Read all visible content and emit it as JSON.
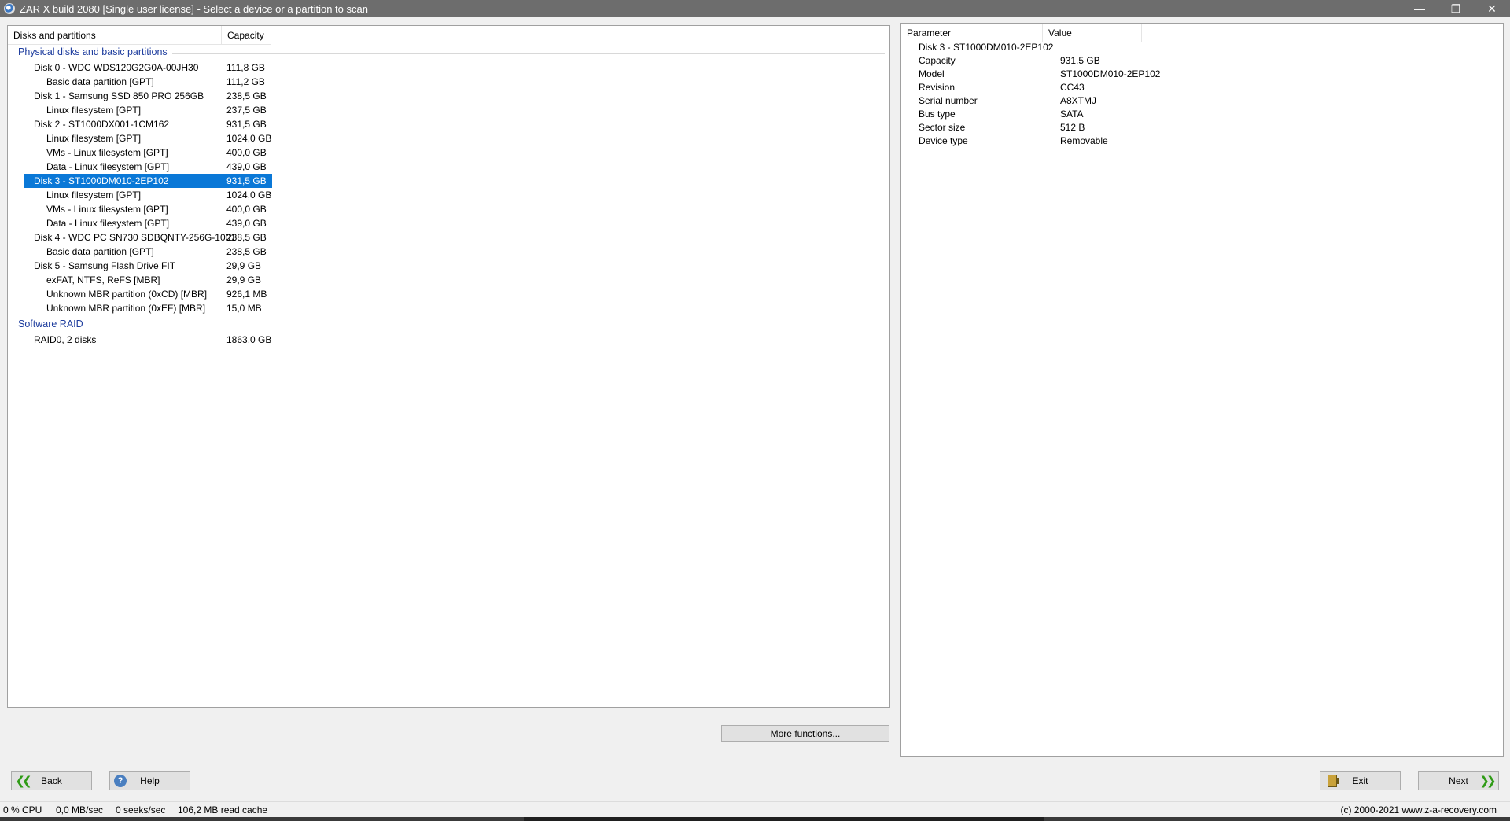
{
  "window": {
    "title": "ZAR X build 2080 [Single user license] - Select a device or a partition to scan",
    "minimize_glyph": "—",
    "restore_glyph": "❐",
    "close_glyph": "✕"
  },
  "tree": {
    "col_name": "Disks and partitions",
    "col_capacity": "Capacity",
    "groups": [
      {
        "label": "Physical disks and basic partitions",
        "rows": [
          {
            "name": "Disk 0 - WDC WDS120G2G0A-00JH30",
            "capacity": "111,8 GB",
            "level": 0
          },
          {
            "name": "Basic data partition [GPT]",
            "capacity": "111,2 GB",
            "level": 1
          },
          {
            "name": "Disk 1 - Samsung SSD 850 PRO 256GB",
            "capacity": "238,5 GB",
            "level": 0
          },
          {
            "name": "Linux filesystem [GPT]",
            "capacity": "237,5 GB",
            "level": 1
          },
          {
            "name": "Disk 2 - ST1000DX001-1CM162",
            "capacity": "931,5 GB",
            "level": 0
          },
          {
            "name": "Linux filesystem [GPT]",
            "capacity": "1024,0 GB",
            "level": 1
          },
          {
            "name": "VMs - Linux filesystem [GPT]",
            "capacity": "400,0 GB",
            "level": 1
          },
          {
            "name": "Data - Linux filesystem [GPT]",
            "capacity": "439,0 GB",
            "level": 1
          },
          {
            "name": "Disk 3 - ST1000DM010-2EP102",
            "capacity": "931,5 GB",
            "level": 0,
            "selected": true
          },
          {
            "name": "Linux filesystem [GPT]",
            "capacity": "1024,0 GB",
            "level": 1
          },
          {
            "name": "VMs - Linux filesystem [GPT]",
            "capacity": "400,0 GB",
            "level": 1
          },
          {
            "name": "Data - Linux filesystem [GPT]",
            "capacity": "439,0 GB",
            "level": 1
          },
          {
            "name": "Disk 4 - WDC PC SN730 SDBQNTY-256G-1001",
            "capacity": "238,5 GB",
            "level": 0
          },
          {
            "name": "Basic data partition [GPT]",
            "capacity": "238,5 GB",
            "level": 1
          },
          {
            "name": "Disk 5 - Samsung Flash Drive FIT",
            "capacity": "29,9 GB",
            "level": 0
          },
          {
            "name": "exFAT, NTFS, ReFS [MBR]",
            "capacity": "29,9 GB",
            "level": 1
          },
          {
            "name": "Unknown MBR partition (0xCD) [MBR]",
            "capacity": "926,1 MB",
            "level": 1
          },
          {
            "name": "Unknown MBR partition (0xEF) [MBR]",
            "capacity": "15,0 MB",
            "level": 1
          }
        ]
      },
      {
        "label": "Software RAID",
        "rows": [
          {
            "name": "RAID0, 2 disks",
            "capacity": "1863,0 GB",
            "level": 0
          }
        ]
      }
    ]
  },
  "details": {
    "col_param": "Parameter",
    "col_value": "Value",
    "heading": "Disk 3 - ST1000DM010-2EP102",
    "rows": [
      {
        "k": "Capacity",
        "v": "931,5 GB"
      },
      {
        "k": "Model",
        "v": "ST1000DM010-2EP102"
      },
      {
        "k": "Revision",
        "v": "CC43"
      },
      {
        "k": "Serial number",
        "v": "A8XTMJ"
      },
      {
        "k": "Bus type",
        "v": "SATA"
      },
      {
        "k": "Sector size",
        "v": "512 B"
      },
      {
        "k": "Device type",
        "v": "Removable"
      }
    ]
  },
  "buttons": {
    "more": "More functions...",
    "back": "Back",
    "help": "Help",
    "exit": "Exit",
    "next": "Next"
  },
  "status": {
    "cpu": "0 % CPU",
    "rate": "0,0 MB/sec",
    "seeks": "0 seeks/sec",
    "cache": "106,2 MB read cache",
    "copyright": "(c) 2000-2021 www.z-a-recovery.com"
  },
  "colors": {
    "selection": "#0a78d7",
    "group_label": "#1e3d9e",
    "titlebar": "#6d6d6d"
  }
}
